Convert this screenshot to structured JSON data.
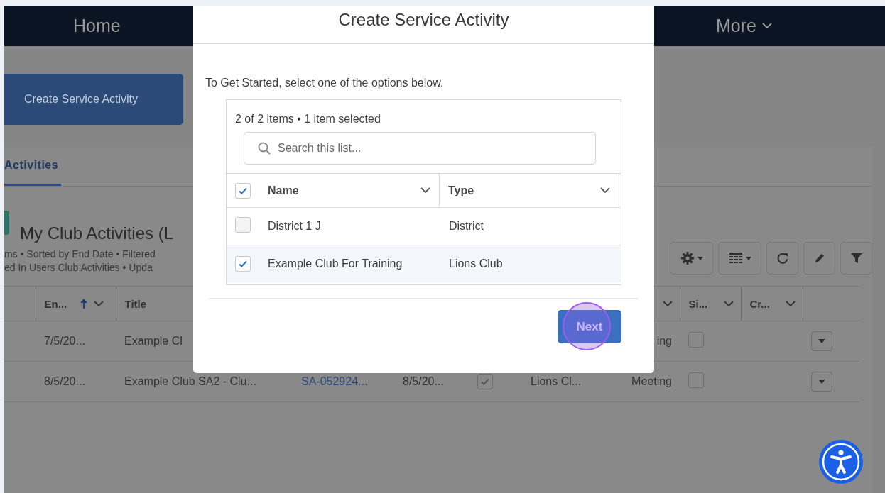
{
  "nav": {
    "items": [
      {
        "label": "Home",
        "has_menu": false
      },
      {
        "label": "More",
        "has_menu": true
      }
    ]
  },
  "page": {
    "primary_button": "Create Service Activity",
    "tabs": [
      {
        "label": "Activities",
        "selected": true
      }
    ],
    "list_title": "My Club Activities (L",
    "list_info": [
      "ms • Sorted by End Date • Filtered",
      "ed In Users Club Activities • Upda"
    ],
    "table": {
      "columns": [
        {
          "kind": "sortable",
          "label": "En...",
          "sort_ascending": true
        },
        {
          "kind": "plain",
          "label": "Title"
        },
        {
          "kind": "covered"
        },
        {
          "kind": "covered"
        },
        {
          "kind": "covered"
        },
        {
          "kind": "covered"
        },
        {
          "kind": "menu_only"
        },
        {
          "kind": "sortable",
          "label": "Si..."
        },
        {
          "kind": "sortable",
          "label": "Cr..."
        },
        {
          "kind": "covered"
        }
      ],
      "rows": [
        {
          "cells": [
            {
              "kind": "text",
              "text": "7/5/20..."
            },
            {
              "kind": "text",
              "text": "Example Cl"
            },
            {
              "kind": "blank"
            },
            {
              "kind": "blank"
            },
            {
              "kind": "blank"
            },
            {
              "kind": "blank"
            },
            {
              "kind": "text",
              "text": "ing"
            },
            {
              "kind": "checkbox",
              "checked": false
            },
            {
              "kind": "blank"
            },
            {
              "kind": "action"
            }
          ]
        },
        {
          "cells": [
            {
              "kind": "text",
              "text": "8/5/20..."
            },
            {
              "kind": "text",
              "text": "Example Club SA2 - Clu..."
            },
            {
              "kind": "link",
              "text": "SA-052924..."
            },
            {
              "kind": "text",
              "text": "8/5/20..."
            },
            {
              "kind": "checkbox",
              "checked": true
            },
            {
              "kind": "text",
              "text": "Lions Cl..."
            },
            {
              "kind": "text",
              "text": "Meeting"
            },
            {
              "kind": "checkbox",
              "checked": false
            },
            {
              "kind": "blank"
            },
            {
              "kind": "action"
            }
          ]
        }
      ]
    }
  },
  "modal": {
    "title": "Create Service Activity",
    "intro": "To Get Started, select one of the options below.",
    "list": {
      "summary": "2 of 2 items • 1 item selected",
      "search_placeholder": "Search this list...",
      "select_all_checked": true,
      "columns": [
        {
          "label": "Name"
        },
        {
          "label": "Type"
        }
      ],
      "rows": [
        {
          "name": "District 1 J",
          "type": "District",
          "checked": false,
          "selected": false
        },
        {
          "name": "Example Club For Training",
          "type": "Lions Club",
          "checked": true,
          "selected": true
        }
      ]
    },
    "next_button": "Next"
  }
}
